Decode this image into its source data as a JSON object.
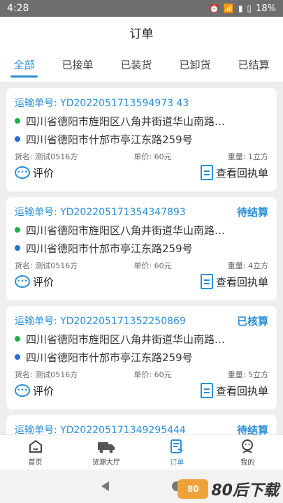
{
  "statusbar": {
    "time": "4:28",
    "battery": "18%"
  },
  "title": "订单",
  "tabs": [
    "全部",
    "已接单",
    "已装货",
    "已卸货",
    "已结算"
  ],
  "labels": {
    "order_prefix": "运输单号: ",
    "goods_prefix": "货名: ",
    "price_prefix": "单价: ",
    "weight_prefix": "重量: ",
    "evaluate": "评价",
    "view_receipt": "查看回执单"
  },
  "orders": [
    {
      "no": "YD2022051713594973 43",
      "status": "",
      "from": "四川省德阳市旌阳区八角井街道华山南路…",
      "to": "四川省德阳市什邡市亭江东路259号",
      "goods": "测试0516方",
      "price": "60元",
      "weight": "1立方"
    },
    {
      "no": "YD202205171354347893",
      "status": "待结算",
      "from": "四川省德阳市旌阳区八角井街道华山南路…",
      "to": "四川省德阳市什邡市亭江东路259号",
      "goods": "测试0516方",
      "price": "60元",
      "weight": "4立方"
    },
    {
      "no": "YD202205171352250869",
      "status": "已核算",
      "from": "四川省德阳市旌阳区八角井街道华山南路…",
      "to": "四川省德阳市什邡市亭江东路259号",
      "goods": "测试0516方",
      "price": "60元",
      "weight": "5立方"
    },
    {
      "no": "YD202205171349295444",
      "status": "待结算",
      "from": "",
      "to": "",
      "goods": "",
      "price": "",
      "weight": ""
    }
  ],
  "bottom_nav": [
    "首页",
    "货源大厅",
    "订单",
    "我的"
  ],
  "watermark": {
    "box": "80",
    "text": "80后下载"
  },
  "colors": {
    "accent": "#2b8fd6",
    "green": "#20b04b",
    "blue": "#2a6ad8"
  }
}
